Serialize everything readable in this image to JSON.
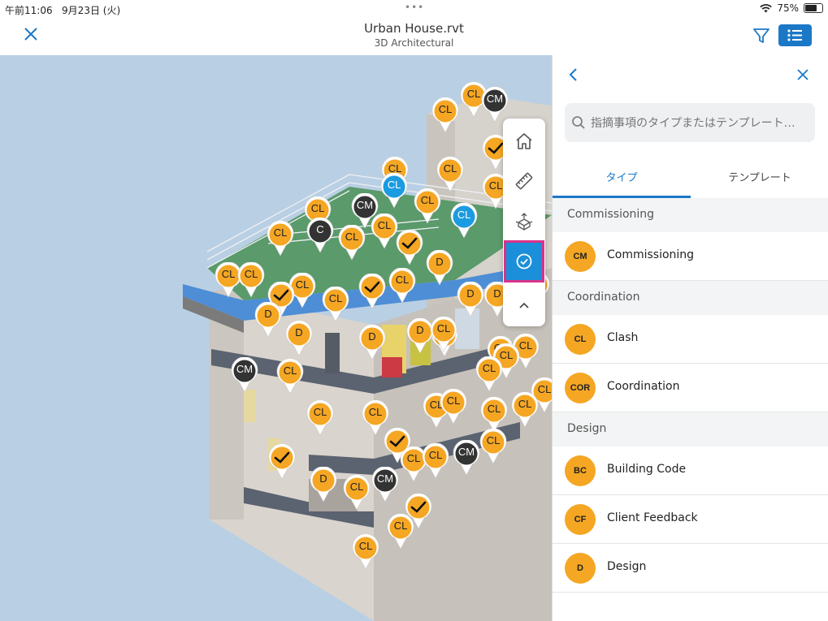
{
  "status": {
    "time": "午前11:06",
    "date": "9月23日 (火)",
    "dots": "•••",
    "battery": "75%",
    "battery_level": 0.75
  },
  "header": {
    "title": "Urban House.rvt",
    "subtitle": "3D Architectural"
  },
  "toolbar": {
    "items": [
      "home-icon",
      "ruler-icon",
      "model-explode-icon",
      "issues-icon",
      "chevron-up-icon"
    ],
    "active": "issues-icon"
  },
  "colors": {
    "accent": "#1b78c7",
    "pin_orange": "#f5a623",
    "pin_dark": "#333333",
    "pin_blue": "#1b9be0",
    "highlight": "#d9338a"
  },
  "pins": [
    {
      "t": "CL",
      "c": "o"
    },
    {
      "t": "CM",
      "c": "d"
    },
    {
      "t": "CL",
      "c": "o"
    },
    {
      "t": "✓",
      "c": "o"
    },
    {
      "t": "CL",
      "c": "o"
    },
    {
      "t": "CL",
      "c": "o"
    },
    {
      "t": "CL",
      "c": "b"
    },
    {
      "t": "CM",
      "c": "d"
    },
    {
      "t": "CL",
      "c": "o"
    },
    {
      "t": "CL",
      "c": "o"
    },
    {
      "t": "CL",
      "c": "b"
    },
    {
      "t": "CL",
      "c": "o"
    },
    {
      "t": "CL",
      "c": "o"
    },
    {
      "t": "C",
      "c": "d"
    },
    {
      "t": "CL",
      "c": "o"
    },
    {
      "t": "CL",
      "c": "o"
    },
    {
      "t": "✓",
      "c": "o"
    },
    {
      "t": "D",
      "c": "o"
    },
    {
      "t": "CL",
      "c": "o"
    },
    {
      "t": "CL",
      "c": "o"
    },
    {
      "t": "CL",
      "c": "o"
    },
    {
      "t": "✓",
      "c": "o"
    },
    {
      "t": "✓",
      "c": "o"
    },
    {
      "t": "CL",
      "c": "o"
    },
    {
      "t": "CL",
      "c": "o"
    },
    {
      "t": "D",
      "c": "o"
    },
    {
      "t": "D",
      "c": "o"
    },
    {
      "t": "CL",
      "c": "o"
    },
    {
      "t": "D",
      "c": "o"
    },
    {
      "t": "D",
      "c": "o"
    },
    {
      "t": "D",
      "c": "o"
    },
    {
      "t": "D",
      "c": "o"
    },
    {
      "t": "CL",
      "c": "o"
    },
    {
      "t": "CL",
      "c": "o"
    },
    {
      "t": "CL",
      "c": "o"
    },
    {
      "t": "CM",
      "c": "d"
    },
    {
      "t": "CL",
      "c": "o"
    },
    {
      "t": "CL",
      "c": "o"
    },
    {
      "t": "CL",
      "c": "o"
    },
    {
      "t": "CL",
      "c": "o"
    },
    {
      "t": "CL",
      "c": "o"
    },
    {
      "t": "CL",
      "c": "o"
    },
    {
      "t": "CL",
      "c": "o"
    },
    {
      "t": "CL",
      "c": "o"
    },
    {
      "t": "CL",
      "c": "o"
    },
    {
      "t": "✓",
      "c": "o"
    },
    {
      "t": "CL",
      "c": "o"
    },
    {
      "t": "CL",
      "c": "o"
    },
    {
      "t": "CL",
      "c": "o"
    },
    {
      "t": "CL",
      "c": "o"
    },
    {
      "t": "✓",
      "c": "o"
    },
    {
      "t": "D",
      "c": "o"
    },
    {
      "t": "CL",
      "c": "o"
    },
    {
      "t": "CM",
      "c": "d"
    },
    {
      "t": "CL",
      "c": "o"
    },
    {
      "t": "✓",
      "c": "o"
    },
    {
      "t": "CL",
      "c": "o"
    },
    {
      "t": "CL",
      "c": "o"
    },
    {
      "t": "CM",
      "c": "d"
    },
    {
      "t": "CL",
      "c": "o"
    }
  ],
  "panel": {
    "search_placeholder": "指摘事項のタイプまたはテンプレート…",
    "tabs": [
      "タイプ",
      "テンプレート"
    ],
    "sections": [
      {
        "title": "Commissioning",
        "items": [
          {
            "abbr": "CM",
            "name": "Commissioning"
          }
        ]
      },
      {
        "title": "Coordination",
        "items": [
          {
            "abbr": "CL",
            "name": "Clash"
          },
          {
            "abbr": "COR",
            "name": "Coordination"
          }
        ]
      },
      {
        "title": "Design",
        "items": [
          {
            "abbr": "BC",
            "name": "Building Code"
          },
          {
            "abbr": "CF",
            "name": "Client Feedback"
          },
          {
            "abbr": "D",
            "name": "Design"
          }
        ]
      }
    ]
  }
}
